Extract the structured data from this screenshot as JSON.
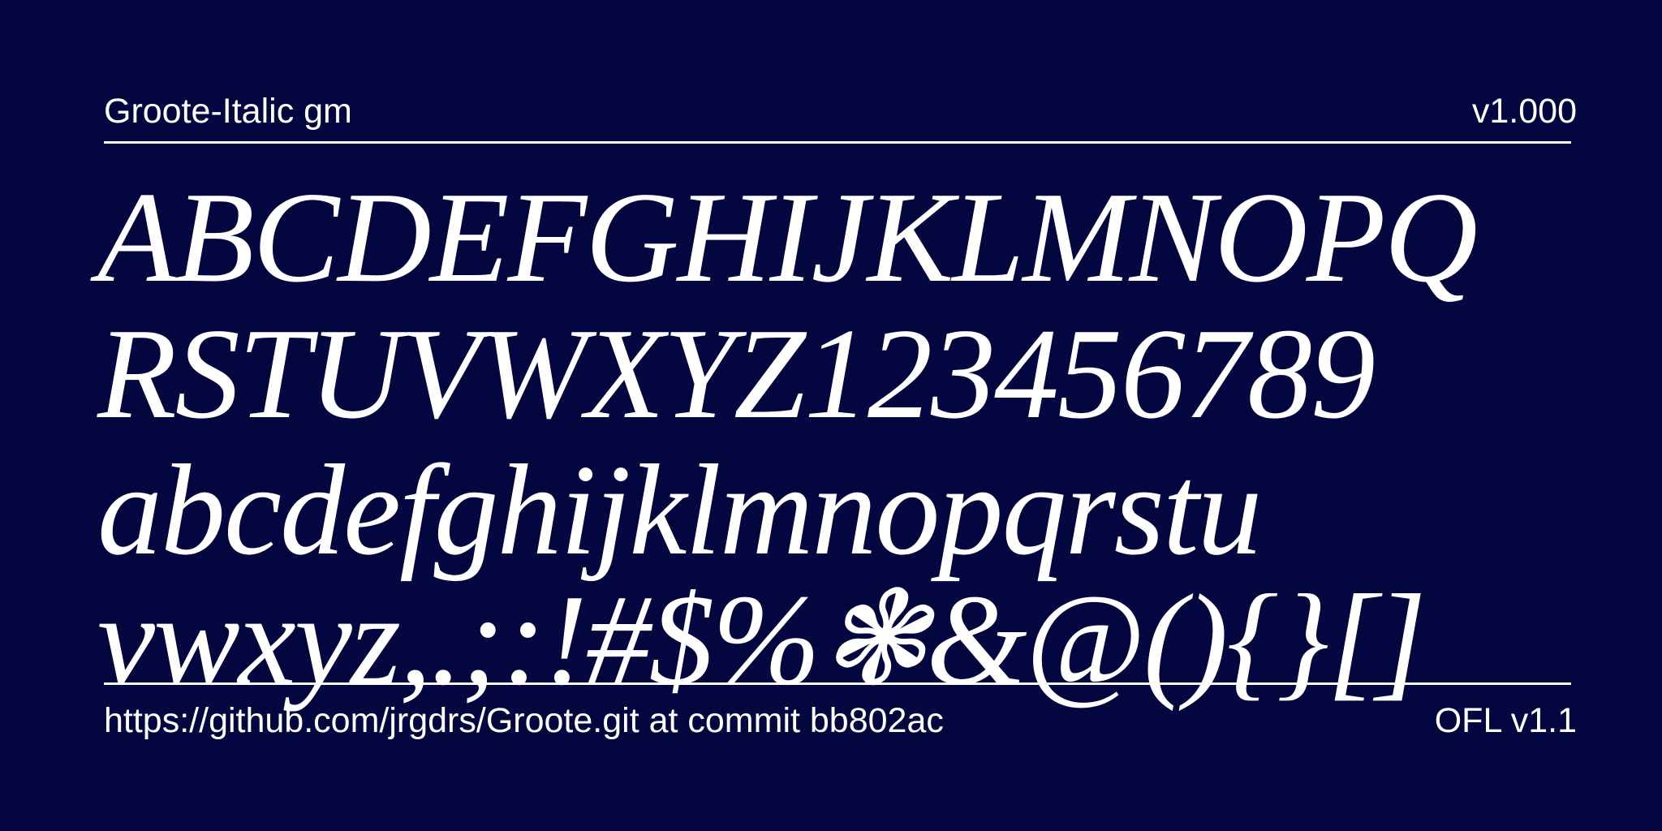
{
  "header": {
    "font_name": "Groote-Italic gm",
    "version": "v1.000"
  },
  "sample": {
    "lines": [
      "ABCDEFGHIJKLMNOPQ",
      "RSTUVWXYZ123456789",
      "abcdefghijklmnopqrstu",
      "vwxyz,.;:!#$%❃&@(){}[]"
    ]
  },
  "footer": {
    "source": "https://github.com/jrgdrs/Groote.git at commit bb802ac",
    "license": "OFL v1.1"
  },
  "colors": {
    "background": "#04073f",
    "foreground": "#ffffff"
  }
}
